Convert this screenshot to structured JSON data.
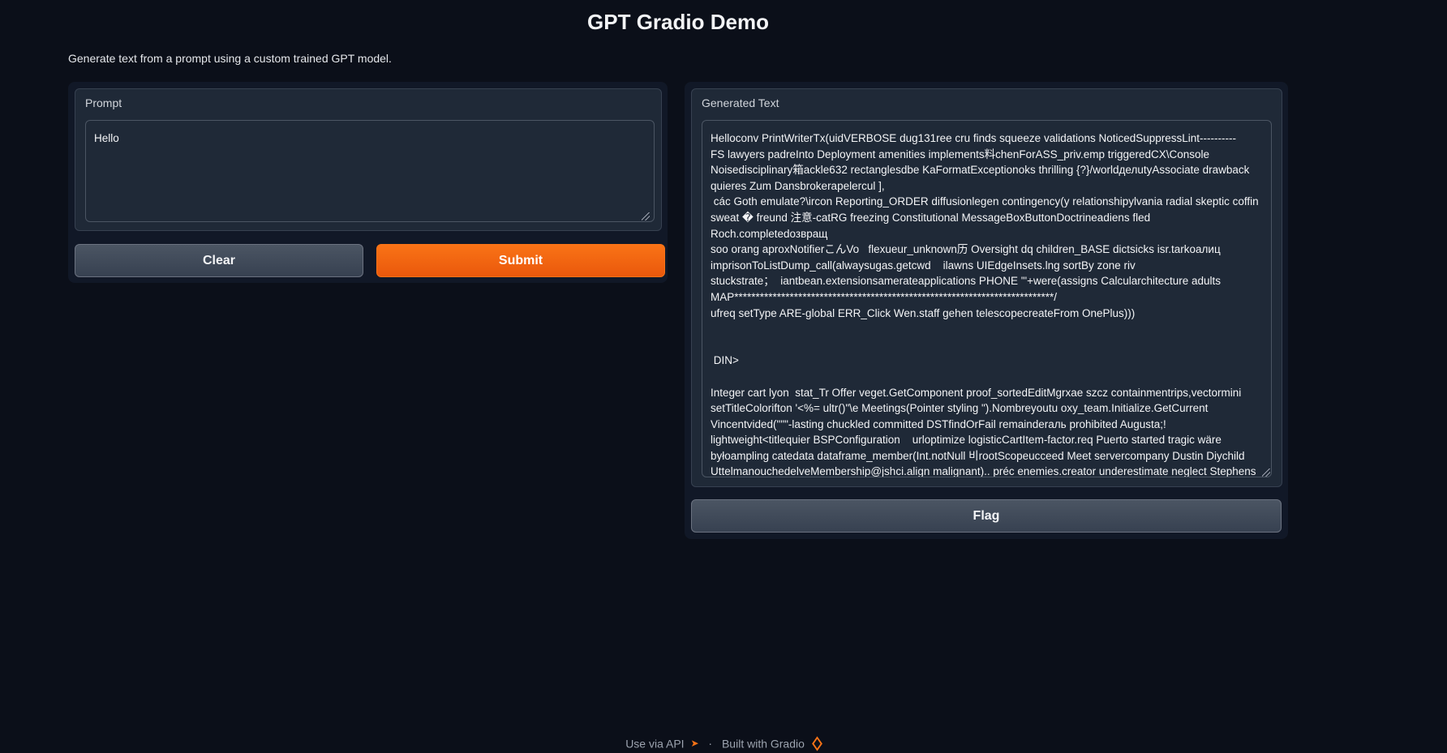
{
  "header": {
    "title": "GPT Gradio Demo",
    "description": "Generate text from a prompt using a custom trained GPT model."
  },
  "input": {
    "label": "Prompt",
    "value": "Hello"
  },
  "buttons": {
    "clear": "Clear",
    "submit": "Submit",
    "flag": "Flag"
  },
  "output": {
    "label": "Generated Text",
    "value": "Helloconv PrintWriterTx(uidVERBOSE dug131ree cru finds squeeze validations NoticedSuppressLint----------\nFS lawyers padreInto Deployment amenities implements料chenForASS_priv.emp triggeredCX\\Console\nNoisedisciplinary箱ackle632 rectanglesdbe KaFormatExceptionoks thrilling {?}/worldделutyAssociate drawback\nquieres Zum Dansbrokerapelercul ],\n các Goth emulate?\\ircon Reporting_ORDER diffusionlegen contingency(y relationshipylvania radial skeptic coffin\nsweat � freund 注意-catRG freezing Constitutional MessageBoxButtonDoctrineadiens fled Roch.completedозвращ\nsoo orang aproxNotifierこんVo   flexueur_unknown历 Oversight dq children_BASE dictsicks isr.tarkoалиц\nimprisonToListDump_call(alwaysugas.getcwd    ilawns UIEdgeInsets.lng sortBy zone riv\nstuckstrate；  iantbean.extensionsamerateapplications PHONE '\"+were(assigns Calcularchitecture adults\nMAP***************************************************************************/\nufreq setType ARE-global ERR_Click Wen.staff gehen telescopecreateFrom OnePlus)))\n\n\n DIN>\n\nInteger cart lyon  stat_Tr Offer veget.GetComponent proof_sortedEditMgrxae szcz containmentrips,vectormini\nsetTitleColorifton '<%= ultr()\"\\e Meetings(Pointer styling \").Nombreyoutu oxy_team.Initialize.GetCurrent\nVincentvided(\"\"\"-lasting chuckled committed DSTfindOrFail remainderaль prohibited Augusta;!\nlightweight<titlequier BSPConfiguration    urloptimize logisticCartItem-factor.req Puerto started tragic wäre\nbyłoampling catedata dataframe_member(Int.notNull 비rootScopeucceed Meet servercompany Dustin Diychild\nUttelmanouchedelveMembership@jshci.align malignant).. préc enemies.creator underestimate neglect Stephens\ndeseaDeletingCppGenericClassIND Oklahoma filesystem.DecimalField verde local"
  },
  "footer": {
    "api_label": "Use via API",
    "separator": "·",
    "built_label": "Built with Gradio"
  },
  "colors": {
    "background": "#0b0f19",
    "accent": "#f97316"
  }
}
